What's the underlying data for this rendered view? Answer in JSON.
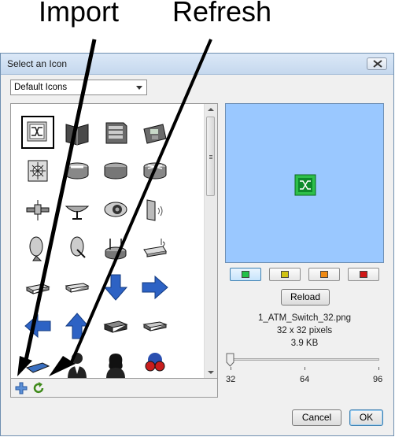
{
  "annotations": {
    "import_label": "Import",
    "refresh_label": "Refresh"
  },
  "dialog": {
    "title": "Select an Icon",
    "close_icon": "close-icon"
  },
  "icon_set": {
    "selected": "Default Icons"
  },
  "icon_grid": {
    "icons": [
      "atm-switch-icon",
      "book-icon",
      "server-rack-icon",
      "ip-phone-icon",
      "router-switch-icon",
      "tape-drive-icon",
      "hub-icon",
      "router-icon",
      "satellite-icon",
      "satellite-dish-icon",
      "camera-icon",
      "wall-speaker-icon",
      "satellite-dish-small-icon",
      "satellite-dish-alt-icon",
      "wireless-router-icon",
      "wireless-access-point-icon",
      "switch-small-icon",
      "switch-flat-icon",
      "arrow-down-icon",
      "arrow-right-icon",
      "arrow-left-icon",
      "arrow-up-icon",
      "server-box-icon",
      "modem-icon",
      "laptop-icon",
      "user-male-icon",
      "user-female-icon",
      "binoculars-user-icon"
    ]
  },
  "toolbar": {
    "import_icon": "add-icon",
    "refresh_icon": "refresh-icon"
  },
  "preview": {
    "background": "#9ac8ff",
    "filename": "1_ATM_Switch_32.png",
    "dimensions": "32 x 32 pixels",
    "size": "3.9 KB",
    "reload_label": "Reload"
  },
  "color_swatches": [
    "#22c14a",
    "#cfc214",
    "#f08a14",
    "#d01818"
  ],
  "size_slider": {
    "value": 32,
    "tick_labels": [
      "32",
      "64",
      "96"
    ]
  },
  "buttons": {
    "cancel_label": "Cancel",
    "ok_label": "OK"
  }
}
